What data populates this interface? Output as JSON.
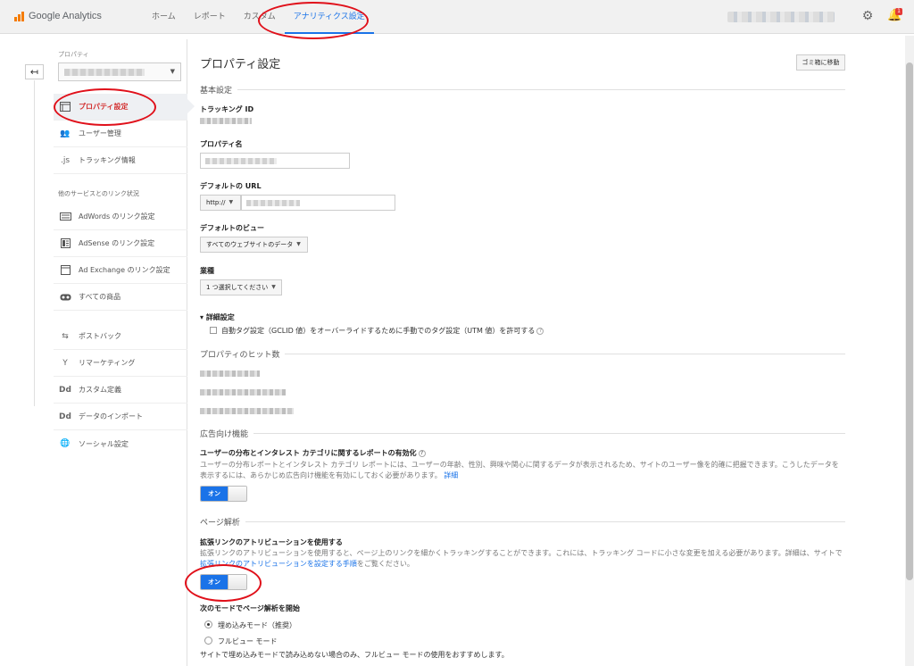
{
  "app": {
    "name": "Google Analytics",
    "accent": "#1a73e8",
    "annotation_color": "#e0101a"
  },
  "nav": {
    "items": [
      {
        "label": "ホーム"
      },
      {
        "label": "レポート"
      },
      {
        "label": "カスタム"
      },
      {
        "label": "アナリティクス設定"
      }
    ],
    "active": "アナリティクス設定"
  },
  "header": {
    "notification_count": "1"
  },
  "sidebar": {
    "property_label": "プロパティ",
    "items": [
      {
        "label": "プロパティ設定",
        "icon": "page-icon"
      },
      {
        "label": "ユーザー管理",
        "icon": "people-icon"
      },
      {
        "label": "トラッキング情報",
        "icon": ".js"
      }
    ],
    "section_label": "他のサービスとのリンク状況",
    "link_items": [
      {
        "label": "AdWords のリンク設定",
        "icon": "adwords-icon"
      },
      {
        "label": "AdSense のリンク設定",
        "icon": "adsense-icon"
      },
      {
        "label": "Ad Exchange のリンク設定",
        "icon": "adexchange-icon"
      },
      {
        "label": "すべての商品",
        "icon": "link-icon"
      }
    ],
    "other_items": [
      {
        "label": "ポストバック",
        "icon": "postback-icon"
      },
      {
        "label": "リマーケティング",
        "icon": "remarketing-icon"
      },
      {
        "label": "カスタム定義",
        "icon": "Dd"
      },
      {
        "label": "データのインポート",
        "icon": "Dd"
      },
      {
        "label": "ソーシャル設定",
        "icon": "globe-icon"
      }
    ]
  },
  "main": {
    "title": "プロパティ設定",
    "trash_button": "ゴミ箱に移動",
    "basic": {
      "heading": "基本設定",
      "tracking_id_label": "トラッキング ID",
      "property_name_label": "プロパティ名",
      "default_url_label": "デフォルトの URL",
      "protocol": "http://",
      "default_view_label": "デフォルトのビュー",
      "default_view_value": "すべてのウェブサイトのデータ",
      "industry_label": "業種",
      "industry_value": "1 つ選択してください",
      "advanced_label": "詳細設定",
      "advanced_checkbox": "自動タグ設定（GCLID 値）をオーバーライドするために手動でのタグ設定（UTM 値）を許可する"
    },
    "hits": {
      "heading": "プロパティのヒット数"
    },
    "ads": {
      "heading": "広告向け機能",
      "feature_label": "ユーザーの分布とインタレスト カテゴリに関するレポートの有効化",
      "desc": "ユーザーの分布レポートとインタレスト カテゴリ レポートには、ユーザーの年齢、性別、興味や関心に関するデータが表示されるため、サイトのユーザー像を的確に把握できます。こうしたデータを表示するには、あらかじめ広告向け機能を有効にしておく必要があります。",
      "desc_link": "詳細",
      "toggle": "オン"
    },
    "page_analysis": {
      "heading": "ページ解析",
      "feature_label": "拡張リンクのアトリビューションを使用する",
      "desc": "拡張リンクのアトリビューションを使用すると、ページ上のリンクを細かくトラッキングすることができます。これには、トラッキング コードに小さな変更を加える必要があります。詳細は、サイトで",
      "desc_link": "拡張リンクのアトリビューションを設定する手順",
      "desc_suffix": "をご覧ください。",
      "toggle": "オン",
      "mode_label": "次のモードでページ解析を開始",
      "mode_embedded": "埋め込みモード（推奨）",
      "mode_fullview": "フルビュー モード",
      "mode_note": "サイトで埋め込みモードで読み込めない場合のみ、フルビュー モードの使用をおすすめします。"
    }
  }
}
